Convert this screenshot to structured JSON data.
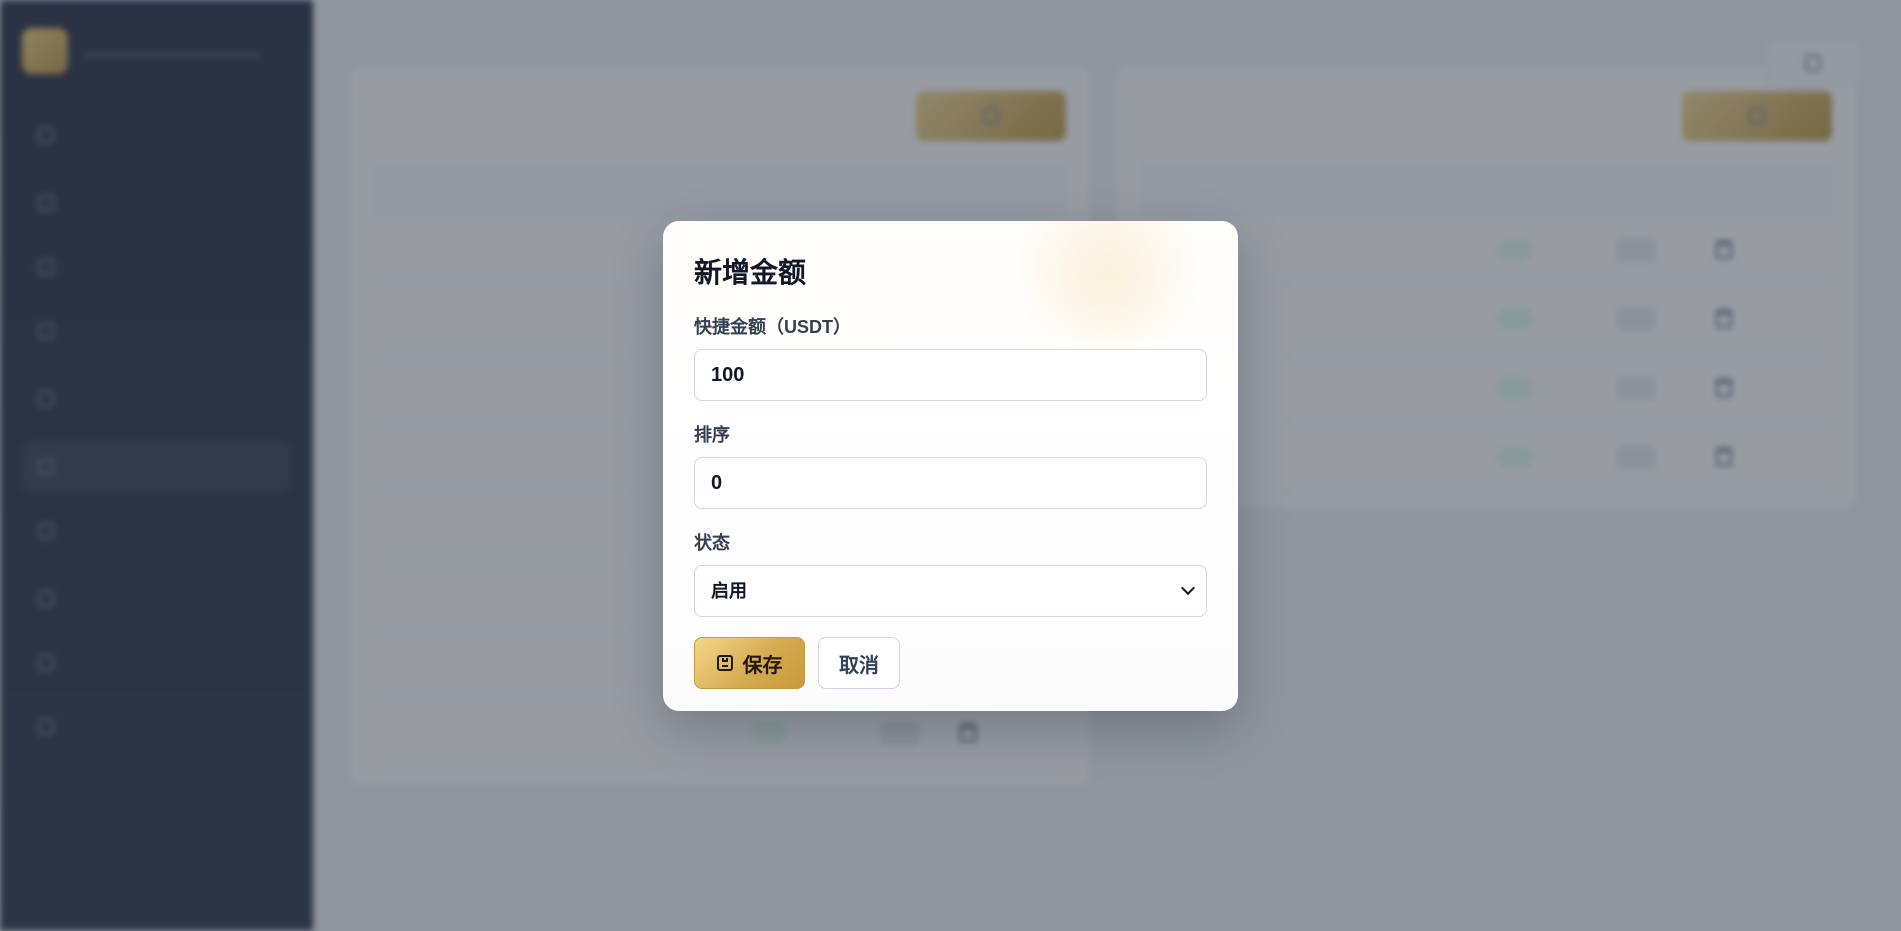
{
  "modal": {
    "title": "新增金额",
    "fields": [
      {
        "label": "快捷金额（USDT）",
        "value": "100"
      },
      {
        "label": "排序",
        "value": "0"
      },
      {
        "label": "状态",
        "value": "启用",
        "options": [
          "启用"
        ]
      }
    ],
    "buttons": {
      "save": "保存",
      "cancel": "取消"
    }
  },
  "colors": {
    "overlay": "#424a58",
    "save_gradient_start": "#f4d78a",
    "save_gradient_end": "#c89a3b",
    "modal_bg": "#ffffff"
  },
  "icons": {
    "save": "save-icon",
    "dropdown": "chevron-down-icon"
  }
}
